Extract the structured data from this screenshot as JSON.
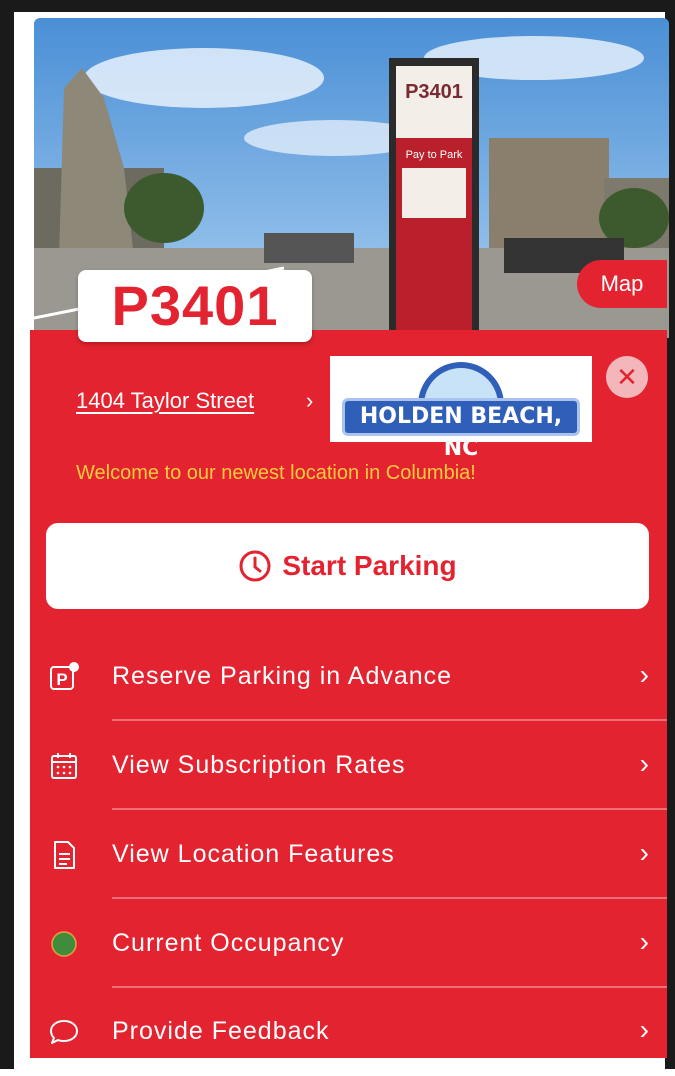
{
  "photo": {
    "sign_code": "P3401",
    "sign_text": "Pay to Park"
  },
  "lot": {
    "code": "P3401"
  },
  "map_button": {
    "label": "Map"
  },
  "location": {
    "address": "1404 Taylor Street",
    "welcome": "Welcome to our newest location in Columbia!"
  },
  "overlay_logo": {
    "text": "HOLDEN BEACH, NC"
  },
  "actions": {
    "start_parking": "Start Parking"
  },
  "menu": [
    {
      "label": "Reserve Parking in Advance",
      "icon": "parking-p-icon"
    },
    {
      "label": "View Subscription Rates",
      "icon": "calendar-icon"
    },
    {
      "label": "View Location Features",
      "icon": "document-icon"
    },
    {
      "label": "Current Occupancy",
      "icon": "status-dot-icon"
    },
    {
      "label": "Provide Feedback",
      "icon": "chat-bubble-icon"
    }
  ],
  "colors": {
    "brand_red": "#e3232f",
    "welcome_yellow": "#ffcb3d",
    "occupancy_green": "#3f8c3f"
  }
}
